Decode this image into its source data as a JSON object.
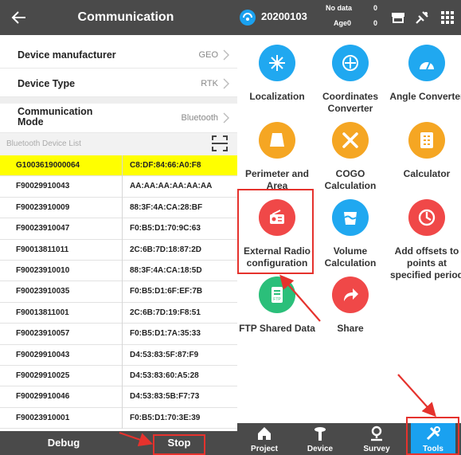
{
  "left": {
    "header": {
      "title": "Communication"
    },
    "settings": [
      {
        "label": "Device manufacturer",
        "value": "GEO"
      },
      {
        "label": "Device Type",
        "value": "RTK"
      },
      {
        "label": "Communication Mode",
        "value": "Bluetooth"
      }
    ],
    "list_header": "Bluetooth Device List",
    "devices": [
      {
        "name": "G1003619000064",
        "address": "C8:DF:84:66:A0:F8",
        "selected": true
      },
      {
        "name": "F90029910043",
        "address": "AA:AA:AA:AA:AA:AA"
      },
      {
        "name": "F90023910009",
        "address": "88:3F:4A:CA:28:BF"
      },
      {
        "name": "F90023910047",
        "address": "F0:B5:D1:70:9C:63"
      },
      {
        "name": "F90013811011",
        "address": "2C:6B:7D:18:87:2D"
      },
      {
        "name": "F90023910010",
        "address": "88:3F:4A:CA:18:5D"
      },
      {
        "name": "F90023910035",
        "address": "F0:B5:D1:6F:EF:7B"
      },
      {
        "name": "F90013811001",
        "address": "2C:6B:7D:19:F8:51"
      },
      {
        "name": "F90023910057",
        "address": "F0:B5:D1:7A:35:33"
      },
      {
        "name": "F90029910043",
        "address": "D4:53:83:5F:87:F9"
      },
      {
        "name": "F90029910025",
        "address": "D4:53:83:60:A5:28"
      },
      {
        "name": "F90029910046",
        "address": "D4:53:83:5B:F7:73"
      },
      {
        "name": "F90023910001",
        "address": "F0:B5:D1:70:3E:39"
      }
    ],
    "footer": {
      "debug": "Debug",
      "stop": "Stop"
    }
  },
  "right": {
    "header": {
      "project": "20200103",
      "status1": "No data",
      "status2": "Age0",
      "num1": "0",
      "num2": "0"
    },
    "tools": [
      {
        "label": "Localization",
        "icon": "localization-icon",
        "color": "#20a8f0"
      },
      {
        "label": "Coordinates Converter",
        "icon": "coordinates-converter-icon",
        "color": "#20a8f0"
      },
      {
        "label": "Angle Converter",
        "icon": "angle-converter-icon",
        "color": "#20a8f0"
      },
      {
        "label": "Perimeter and Area",
        "icon": "perimeter-area-icon",
        "color": "#f5a623"
      },
      {
        "label": "COGO Calculation",
        "icon": "cogo-icon",
        "color": "#f5a623"
      },
      {
        "label": "Calculator",
        "icon": "calculator-icon",
        "color": "#f5a623"
      },
      {
        "label": "External Radio configuration",
        "icon": "external-radio-icon",
        "color": "#f04848"
      },
      {
        "label": "Volume Calculation",
        "icon": "volume-icon",
        "color": "#20a8f0"
      },
      {
        "label": "Add offsets to points at specified period",
        "icon": "add-offsets-icon",
        "color": "#f04848"
      },
      {
        "label": "FTP Shared Data",
        "icon": "ftp-icon",
        "color": "#2bbf7a"
      },
      {
        "label": "Share",
        "icon": "share-icon",
        "color": "#f04848"
      }
    ],
    "nav": [
      {
        "label": "Project"
      },
      {
        "label": "Device"
      },
      {
        "label": "Survey"
      },
      {
        "label": "Tools",
        "active": true
      }
    ]
  },
  "colors": {
    "header_bg": "#4a4a4a",
    "selected_row": "#ffff00",
    "accent_blue": "#1aa1f0",
    "highlight_red": "#e5322d"
  }
}
